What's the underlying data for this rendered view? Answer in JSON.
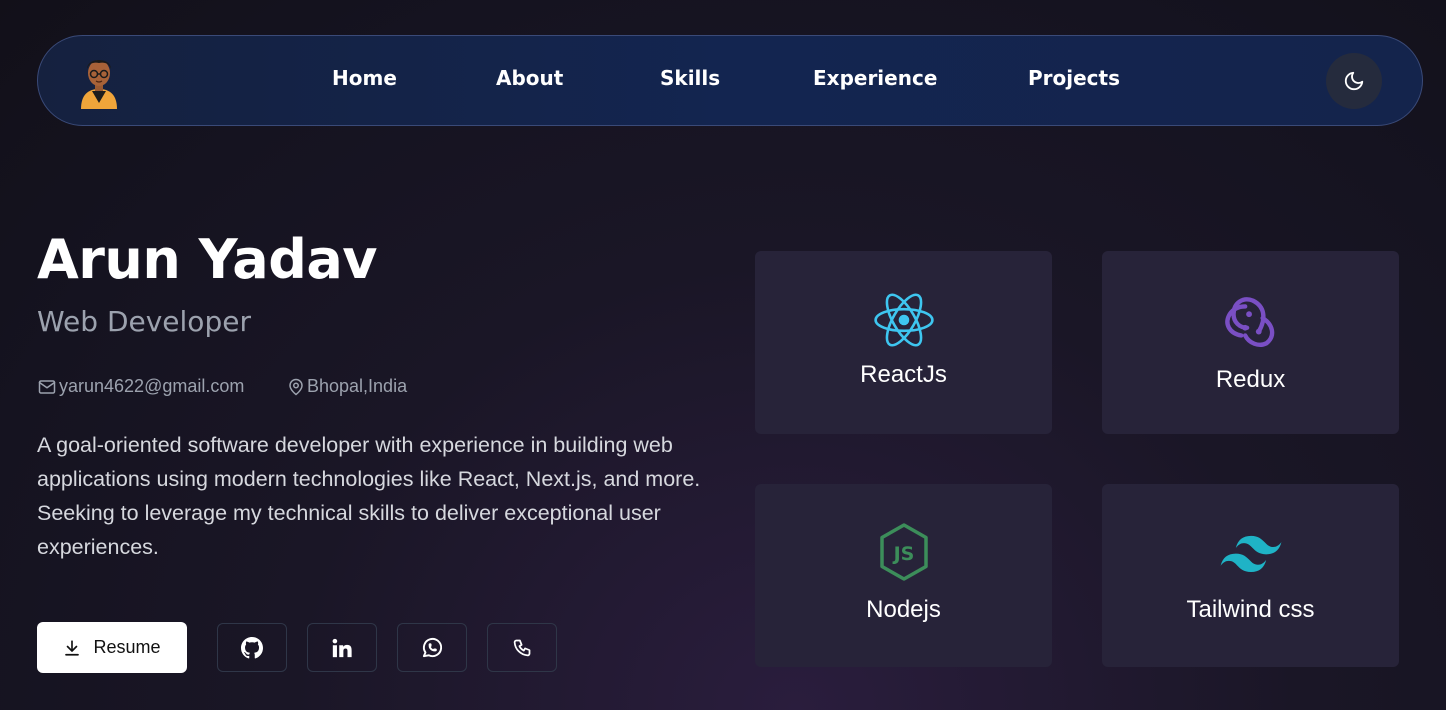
{
  "nav": {
    "avatar_alt": "avatar",
    "links": [
      "Home",
      "About",
      "Skills",
      "Experience",
      "Projects"
    ],
    "theme_icon": "moon-icon"
  },
  "hero": {
    "name": "Arun Yadav",
    "role": "Web Developer",
    "email": "yarun4622@gmail.com",
    "location": "Bhopal,India",
    "bio": "A goal-oriented software developer with experience in building web applications using modern technologies like React, Next.js, and more. Seeking to leverage my technical skills to deliver exceptional user experiences.",
    "resume_label": "Resume",
    "socials": [
      "github-icon",
      "linkedin-icon",
      "whatsapp-icon",
      "phone-icon"
    ]
  },
  "skills": [
    {
      "label": "ReactJs",
      "icon": "react-icon",
      "color": "#3ec6f0"
    },
    {
      "label": "Redux",
      "icon": "redux-icon",
      "color": "#7a4fc4"
    },
    {
      "label": "Nodejs",
      "icon": "nodejs-icon",
      "color": "#3c8d5a"
    },
    {
      "label": "Tailwind css",
      "icon": "tailwind-icon",
      "color": "#1fb3c6"
    }
  ],
  "colors": {
    "background": "#151320",
    "navbar": "#132550",
    "card": "#272339",
    "muted_text": "#9ca2ae"
  }
}
